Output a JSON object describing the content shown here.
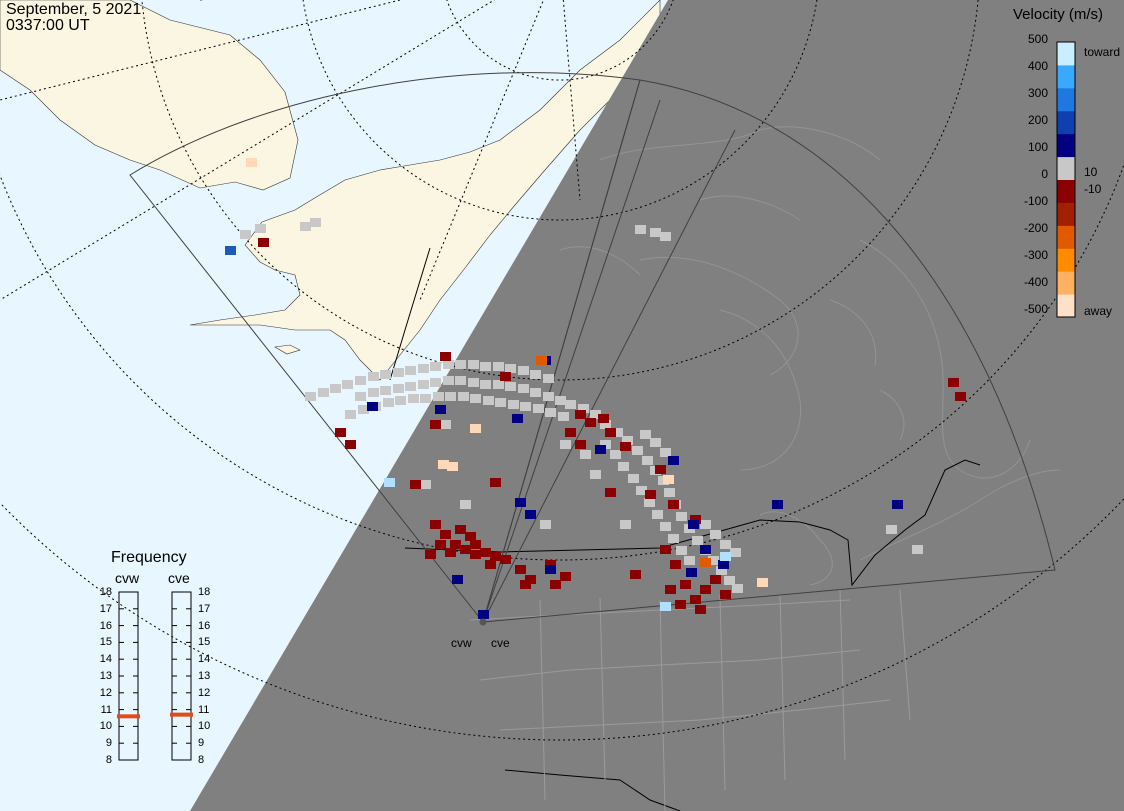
{
  "header": {
    "date": "September, 5 2021",
    "time": "0337:00 UT"
  },
  "colorbar": {
    "title": "Velocity (m/s)",
    "ticks": [
      "500",
      "400",
      "300",
      "200",
      "100",
      "0",
      "-100",
      "-200",
      "-300",
      "-400",
      "-500"
    ],
    "side_labels": {
      "top": "toward",
      "mid_high": "10",
      "mid_low": "-10",
      "bottom": "away"
    },
    "colors": [
      "#ffe0c8",
      "#ffb060",
      "#ff8c00",
      "#e05a00",
      "#a02000",
      "#8b0000",
      "#c8c8c8",
      "#000080",
      "#1040b0",
      "#1e78e0",
      "#3aa8ff",
      "#c8eeff"
    ]
  },
  "frequency": {
    "title": "Frequency",
    "radars": [
      {
        "name": "cvw",
        "freq": 10.6
      },
      {
        "name": "cve",
        "freq": 10.7
      }
    ],
    "scale": [
      "18",
      "17",
      "16",
      "15",
      "14",
      "13",
      "12",
      "11",
      "10",
      "9",
      "8"
    ]
  },
  "radars": [
    {
      "name": "cvw"
    },
    {
      "name": "cve"
    }
  ],
  "map_colors": {
    "ocean_day": "#e8f6ff",
    "land_day": "#fbf6e2",
    "night": "#808080",
    "ground_scatter": "#c8c8c8"
  }
}
